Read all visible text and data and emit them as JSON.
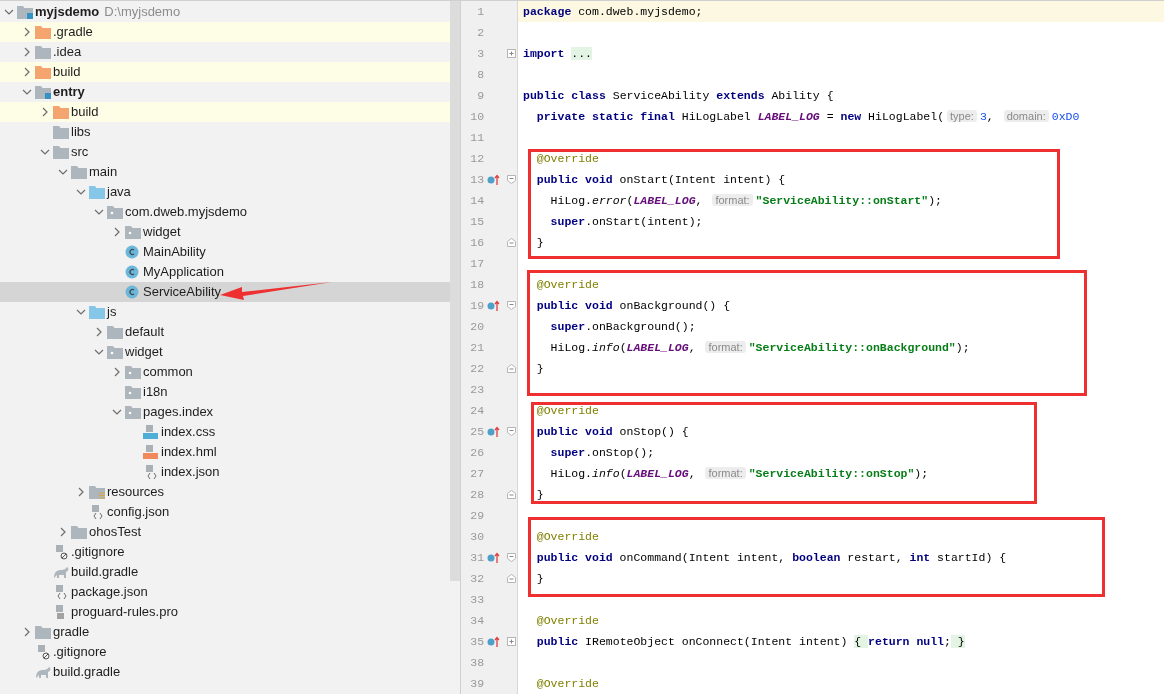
{
  "project_tree": {
    "label": "myjsdemo",
    "path": "D:\\myjsdemo",
    "kind": "module",
    "bold": true,
    "expanded": true,
    "excluded": false,
    "selected": false,
    "children": [
      {
        "label": ".gradle",
        "kind": "folder-excluded",
        "expanded": false,
        "excluded": true,
        "selected": false
      },
      {
        "label": ".idea",
        "kind": "folder",
        "expanded": false,
        "excluded": false,
        "selected": false
      },
      {
        "label": "build",
        "kind": "folder-excluded",
        "expanded": false,
        "excluded": true,
        "selected": false
      },
      {
        "label": "entry",
        "kind": "module",
        "bold": true,
        "expanded": true,
        "excluded": false,
        "selected": false,
        "children": [
          {
            "label": "build",
            "kind": "folder-excluded",
            "expanded": false,
            "excluded": true,
            "selected": false
          },
          {
            "label": "libs",
            "kind": "folder",
            "excluded": false,
            "selected": false
          },
          {
            "label": "src",
            "kind": "folder",
            "expanded": true,
            "excluded": false,
            "selected": false,
            "children": [
              {
                "label": "main",
                "kind": "folder",
                "expanded": true,
                "excluded": false,
                "selected": false,
                "children": [
                  {
                    "label": "java",
                    "kind": "source",
                    "expanded": true,
                    "excluded": false,
                    "selected": false,
                    "children": [
                      {
                        "label": "com.dweb.myjsdemo",
                        "kind": "package",
                        "expanded": true,
                        "excluded": false,
                        "selected": false,
                        "children": [
                          {
                            "label": "widget",
                            "kind": "package",
                            "expanded": false,
                            "excluded": false,
                            "selected": false
                          },
                          {
                            "label": "MainAbility",
                            "kind": "class",
                            "excluded": false,
                            "selected": false
                          },
                          {
                            "label": "MyApplication",
                            "kind": "class",
                            "excluded": false,
                            "selected": false
                          },
                          {
                            "label": "ServiceAbility",
                            "kind": "class",
                            "excluded": false,
                            "selected": true
                          }
                        ]
                      }
                    ]
                  },
                  {
                    "label": "js",
                    "kind": "source",
                    "expanded": true,
                    "excluded": false,
                    "selected": false,
                    "children": [
                      {
                        "label": "default",
                        "kind": "folder",
                        "expanded": false,
                        "excluded": false,
                        "selected": false
                      },
                      {
                        "label": "widget",
                        "kind": "package",
                        "expanded": true,
                        "excluded": false,
                        "selected": false,
                        "children": [
                          {
                            "label": "common",
                            "kind": "package",
                            "expanded": false,
                            "excluded": false,
                            "selected": false
                          },
                          {
                            "label": "i18n",
                            "kind": "package",
                            "excluded": false,
                            "selected": false
                          },
                          {
                            "label": "pages.index",
                            "kind": "package",
                            "expanded": true,
                            "excluded": false,
                            "selected": false,
                            "children": [
                              {
                                "label": "index.css",
                                "kind": "css",
                                "excluded": false,
                                "selected": false
                              },
                              {
                                "label": "index.hml",
                                "kind": "hml",
                                "excluded": false,
                                "selected": false
                              },
                              {
                                "label": "index.json",
                                "kind": "json",
                                "excluded": false,
                                "selected": false
                              }
                            ]
                          }
                        ]
                      }
                    ]
                  },
                  {
                    "label": "resources",
                    "kind": "resources",
                    "expanded": false,
                    "excluded": false,
                    "selected": false
                  },
                  {
                    "label": "config.json",
                    "kind": "json",
                    "excluded": false,
                    "selected": false
                  }
                ]
              },
              {
                "label": "ohosTest",
                "kind": "folder",
                "expanded": false,
                "excluded": false,
                "selected": false
              }
            ]
          },
          {
            "label": ".gitignore",
            "kind": "ignore",
            "excluded": false,
            "selected": false
          },
          {
            "label": "build.gradle",
            "kind": "gradle",
            "excluded": false,
            "selected": false
          },
          {
            "label": "package.json",
            "kind": "json",
            "excluded": false,
            "selected": false
          },
          {
            "label": "proguard-rules.pro",
            "kind": "text",
            "excluded": false,
            "selected": false
          }
        ]
      },
      {
        "label": "gradle",
        "kind": "folder",
        "expanded": false,
        "excluded": false,
        "selected": false
      },
      {
        "label": ".gitignore",
        "kind": "ignore",
        "excluded": false,
        "selected": false
      },
      {
        "label": "build.gradle",
        "kind": "gradle",
        "excluded": false,
        "selected": false
      }
    ]
  },
  "editor": {
    "lines": [
      {
        "number": "1",
        "current": true,
        "tokens": [
          {
            "kind": "kw",
            "text": "package"
          },
          {
            "kind": "plain",
            "text": " com.dweb.myjsdemo;"
          }
        ]
      },
      {
        "number": "2",
        "current": false
      },
      {
        "number": "3",
        "current": false,
        "fold": {
          "kind": "collapsed"
        },
        "tokens": [
          {
            "kind": "kw",
            "text": "import "
          },
          {
            "kind": "folded",
            "text": "..."
          }
        ]
      },
      {
        "number": "8",
        "current": false
      },
      {
        "number": "9",
        "current": false,
        "tokens": [
          {
            "kind": "kw",
            "text": "public class"
          },
          {
            "kind": "plain",
            "text": " ServiceAbility "
          },
          {
            "kind": "kw",
            "text": "extends"
          },
          {
            "kind": "plain",
            "text": " Ability {"
          }
        ]
      },
      {
        "number": "10",
        "current": false,
        "tokens": [
          {
            "kind": "kw",
            "text": "  private static final"
          },
          {
            "kind": "plain",
            "text": " HiLogLabel "
          },
          {
            "kind": "field",
            "text": "LABEL_LOG"
          },
          {
            "kind": "plain",
            "text": " = "
          },
          {
            "kind": "kw",
            "text": "new"
          },
          {
            "kind": "plain",
            "text": " HiLogLabel("
          },
          {
            "kind": "hint",
            "text": "type:"
          },
          {
            "kind": "num",
            "text": "3"
          },
          {
            "kind": "plain",
            "text": ", "
          },
          {
            "kind": "hint",
            "text": "domain:"
          },
          {
            "kind": "num",
            "text": "0xD0"
          }
        ]
      },
      {
        "number": "11",
        "current": false
      },
      {
        "number": "12",
        "current": false,
        "tokens": [
          {
            "kind": "ann",
            "text": "  @Override"
          }
        ]
      },
      {
        "number": "13",
        "current": false,
        "override": true,
        "fold": {
          "kind": "start"
        },
        "tokens": [
          {
            "kind": "kw",
            "text": "  public void"
          },
          {
            "kind": "plain",
            "text": " onStart(Intent intent) {"
          }
        ]
      },
      {
        "number": "14",
        "current": false,
        "tokens": [
          {
            "kind": "plain",
            "text": "    HiLog."
          },
          {
            "kind": "method",
            "text": "error"
          },
          {
            "kind": "plain",
            "text": "("
          },
          {
            "kind": "field",
            "text": "LABEL_LOG"
          },
          {
            "kind": "plain",
            "text": ", "
          },
          {
            "kind": "hint",
            "text": "format:"
          },
          {
            "kind": "str",
            "text": "\"ServiceAbility::onStart\""
          },
          {
            "kind": "plain",
            "text": ");"
          }
        ]
      },
      {
        "number": "15",
        "current": false,
        "tokens": [
          {
            "kind": "kw",
            "text": "    super"
          },
          {
            "kind": "plain",
            "text": ".onStart(intent);"
          }
        ]
      },
      {
        "number": "16",
        "current": false,
        "fold": {
          "kind": "end"
        },
        "tokens": [
          {
            "kind": "plain",
            "text": "  }"
          }
        ]
      },
      {
        "number": "17",
        "current": false
      },
      {
        "number": "18",
        "current": false,
        "tokens": [
          {
            "kind": "ann",
            "text": "  @Override"
          }
        ]
      },
      {
        "number": "19",
        "current": false,
        "override": true,
        "fold": {
          "kind": "start"
        },
        "tokens": [
          {
            "kind": "kw",
            "text": "  public void"
          },
          {
            "kind": "plain",
            "text": " onBackground() {"
          }
        ]
      },
      {
        "number": "20",
        "current": false,
        "tokens": [
          {
            "kind": "kw",
            "text": "    super"
          },
          {
            "kind": "plain",
            "text": ".onBackground();"
          }
        ]
      },
      {
        "number": "21",
        "current": false,
        "tokens": [
          {
            "kind": "plain",
            "text": "    HiLog."
          },
          {
            "kind": "method",
            "text": "info"
          },
          {
            "kind": "plain",
            "text": "("
          },
          {
            "kind": "field",
            "text": "LABEL_LOG"
          },
          {
            "kind": "plain",
            "text": ", "
          },
          {
            "kind": "hint",
            "text": "format:"
          },
          {
            "kind": "str",
            "text": "\"ServiceAbility::onBackground\""
          },
          {
            "kind": "plain",
            "text": ");"
          }
        ]
      },
      {
        "number": "22",
        "current": false,
        "fold": {
          "kind": "end"
        },
        "tokens": [
          {
            "kind": "plain",
            "text": "  }"
          }
        ]
      },
      {
        "number": "23",
        "current": false
      },
      {
        "number": "24",
        "current": false,
        "tokens": [
          {
            "kind": "ann",
            "text": "  @Override"
          }
        ]
      },
      {
        "number": "25",
        "current": false,
        "override": true,
        "fold": {
          "kind": "start"
        },
        "tokens": [
          {
            "kind": "kw",
            "text": "  public void"
          },
          {
            "kind": "plain",
            "text": " onStop() {"
          }
        ]
      },
      {
        "number": "26",
        "current": false,
        "tokens": [
          {
            "kind": "kw",
            "text": "    super"
          },
          {
            "kind": "plain",
            "text": ".onStop();"
          }
        ]
      },
      {
        "number": "27",
        "current": false,
        "tokens": [
          {
            "kind": "plain",
            "text": "    HiLog."
          },
          {
            "kind": "method",
            "text": "info"
          },
          {
            "kind": "plain",
            "text": "("
          },
          {
            "kind": "field",
            "text": "LABEL_LOG"
          },
          {
            "kind": "plain",
            "text": ", "
          },
          {
            "kind": "hint",
            "text": "format:"
          },
          {
            "kind": "str",
            "text": "\"ServiceAbility::onStop\""
          },
          {
            "kind": "plain",
            "text": ");"
          }
        ]
      },
      {
        "number": "28",
        "current": false,
        "fold": {
          "kind": "end"
        },
        "tokens": [
          {
            "kind": "plain",
            "text": "  }"
          }
        ]
      },
      {
        "number": "29",
        "current": false
      },
      {
        "number": "30",
        "current": false,
        "tokens": [
          {
            "kind": "ann",
            "text": "  @Override"
          }
        ]
      },
      {
        "number": "31",
        "current": false,
        "override": true,
        "fold": {
          "kind": "start"
        },
        "tokens": [
          {
            "kind": "kw",
            "text": "  public void"
          },
          {
            "kind": "plain",
            "text": " onCommand(Intent intent, "
          },
          {
            "kind": "kw",
            "text": "boolean"
          },
          {
            "kind": "plain",
            "text": " restart, "
          },
          {
            "kind": "kw",
            "text": "int"
          },
          {
            "kind": "plain",
            "text": " startId) {"
          }
        ]
      },
      {
        "number": "32",
        "current": false,
        "fold": {
          "kind": "end"
        },
        "tokens": [
          {
            "kind": "plain",
            "text": "  }"
          }
        ]
      },
      {
        "number": "33",
        "current": false
      },
      {
        "number": "34",
        "current": false,
        "tokens": [
          {
            "kind": "ann",
            "text": "  @Override"
          }
        ]
      },
      {
        "number": "35",
        "current": false,
        "override": true,
        "fold": {
          "kind": "collapsed"
        },
        "tokens": [
          {
            "kind": "kw",
            "text": "  public"
          },
          {
            "kind": "plain",
            "text": " IRemoteObject onConnect(Intent intent) "
          },
          {
            "kind": "folded",
            "text": "{ "
          },
          {
            "kind": "kw",
            "text": "return null"
          },
          {
            "kind": "plain",
            "text": ";"
          },
          {
            "kind": "folded",
            "text": " }"
          }
        ]
      },
      {
        "number": "38",
        "current": false
      },
      {
        "number": "39",
        "current": false,
        "tokens": [
          {
            "kind": "ann",
            "text": "  @Override"
          }
        ]
      }
    ]
  }
}
